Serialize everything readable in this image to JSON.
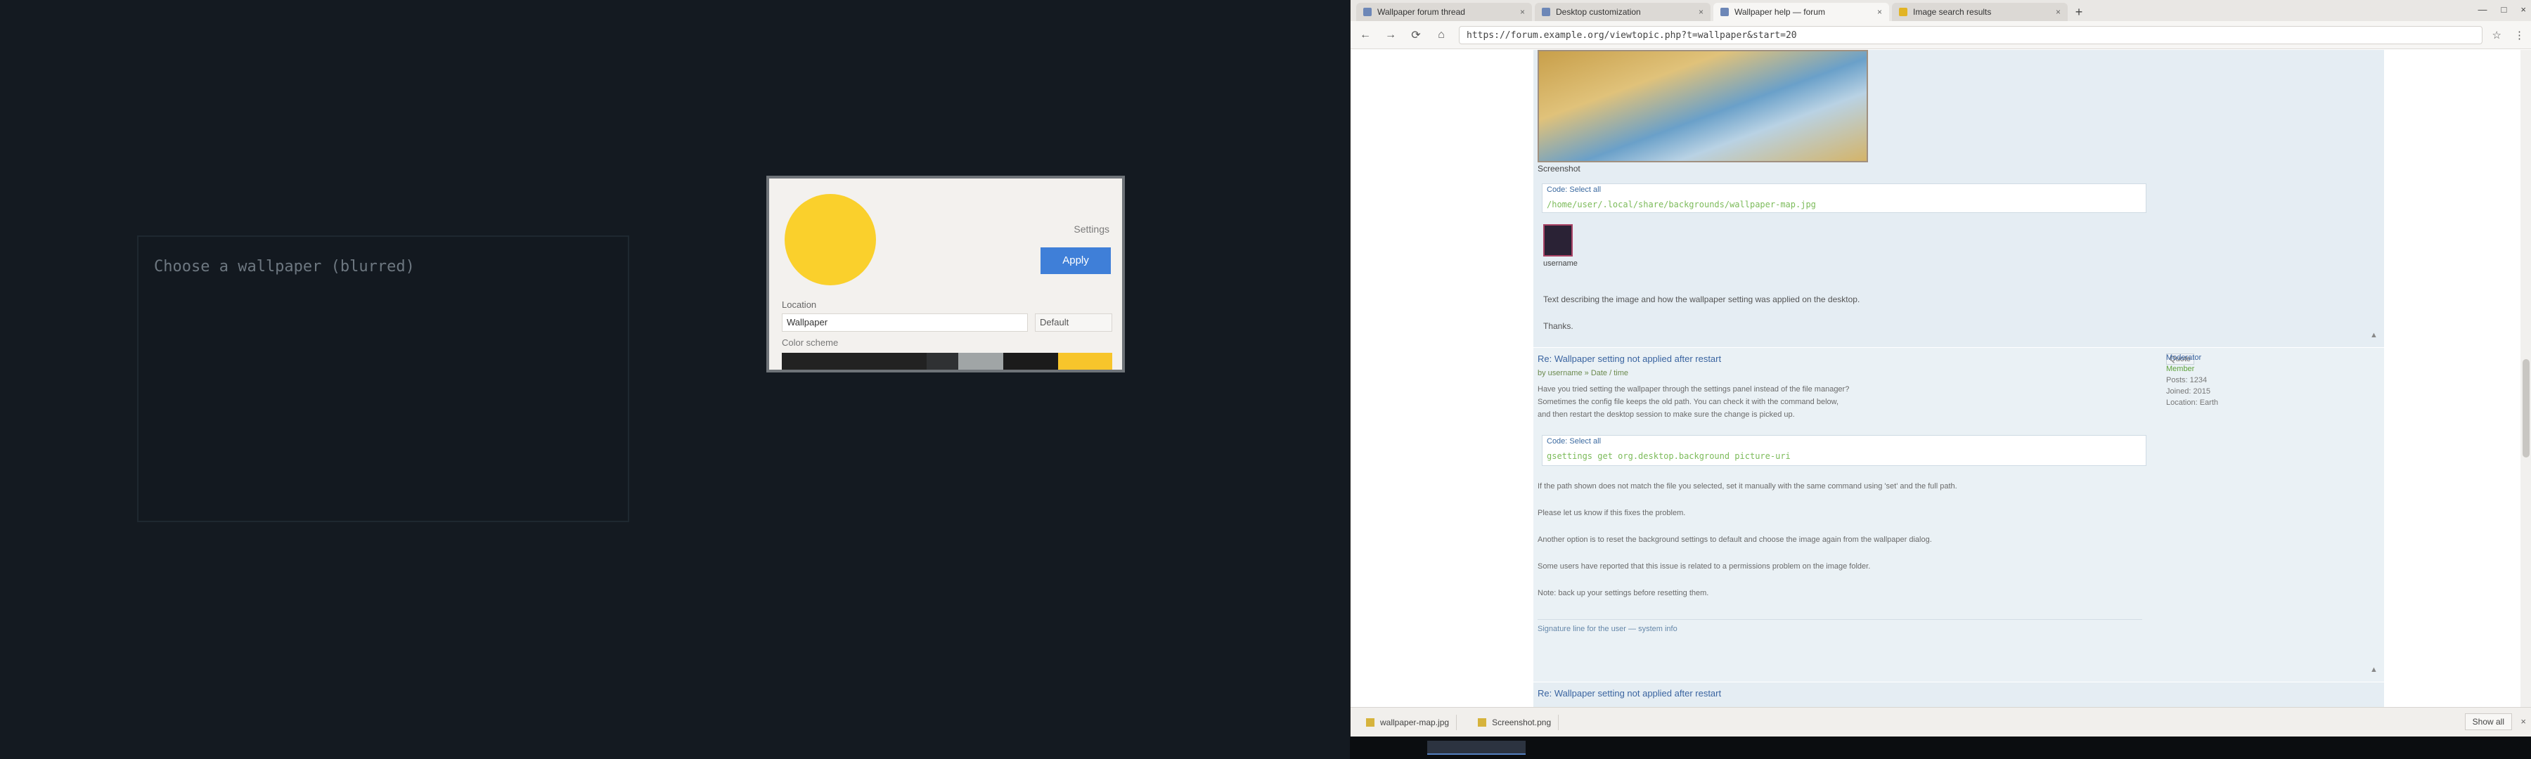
{
  "left_panel": {
    "title": "Choose a wallpaper (blurred)"
  },
  "preview": {
    "link": "Settings",
    "button": "Apply",
    "field_label": "Location",
    "input_value": "Wallpaper",
    "select_value": "Default",
    "sub_label": "Color scheme"
  },
  "browser": {
    "tabs": [
      {
        "label": "Wallpaper forum thread",
        "close": "×"
      },
      {
        "label": "Desktop customization",
        "close": "×"
      },
      {
        "label": "Wallpaper help — forum",
        "close": "×"
      },
      {
        "label": "Image search results",
        "close": "×"
      }
    ],
    "new_tab": "+",
    "window_controls": [
      "—",
      "□",
      "×"
    ],
    "nav": {
      "back": "←",
      "forward": "→",
      "reload": "⟳",
      "home": "⌂"
    },
    "url": "https://forum.example.org/viewtopic.php?t=wallpaper&start=20",
    "toolbar_right": [
      "☆",
      "⋮"
    ]
  },
  "posts": [
    {
      "map_caption": "Screenshot",
      "quote_label": "Code: Select all",
      "quote_text": "/home/user/.local/share/backgrounds/wallpaper-map.jpg",
      "avatar_name": "username",
      "body": "Text describing the image and how the wallpaper setting was applied on the desktop.",
      "footer": "Thanks."
    },
    {
      "title": "Re: Wallpaper setting not applied after restart",
      "subtitle": "by username » Date / time",
      "button": "Quote",
      "lines": [
        "Have you tried setting the wallpaper through the settings panel instead of the file manager?",
        "Sometimes the config file keeps the old path. You can check it with the command below,",
        "and then restart the desktop session to make sure the change is picked up."
      ],
      "quote_label": "Code: Select all",
      "quote_text": "gsettings get org.desktop.background picture-uri",
      "paragraphs": [
        "If the path shown does not match the file you selected, set it manually with the same command using 'set' and the full path.",
        "Please let us know if this fixes the problem.",
        "Another option is to reset the background settings to default and choose the image again from the wallpaper dialog.",
        "Some users have reported that this issue is related to a permissions problem on the image folder."
      ],
      "red_note": "Note: back up your settings before resetting them.",
      "signature": "Signature line for the user — system info",
      "side_user": {
        "name": "Moderator",
        "rank": "Member",
        "meta": [
          "Posts: 1234",
          "Joined: 2015",
          "Location: Earth"
        ]
      }
    },
    {
      "title": "Re: Wallpaper setting not applied after restart"
    }
  ],
  "downloads": {
    "items": [
      {
        "label": "wallpaper-map.jpg"
      },
      {
        "label": "Screenshot.png"
      }
    ],
    "show_all": "Show all",
    "close": "×"
  }
}
